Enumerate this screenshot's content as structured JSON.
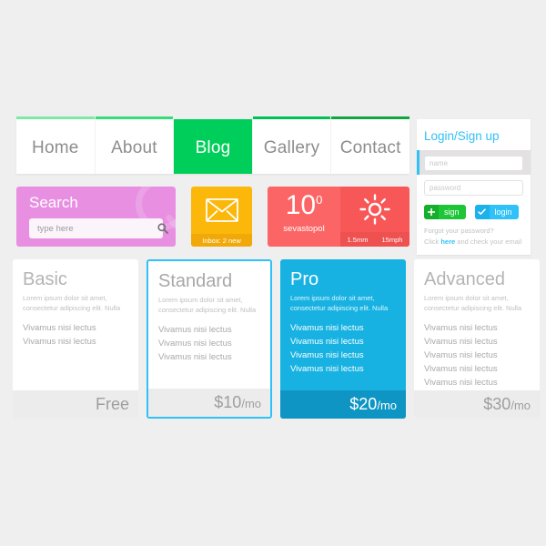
{
  "nav": {
    "items": [
      {
        "label": "Home",
        "accent": "#7ee8a5",
        "active": false
      },
      {
        "label": "About",
        "accent": "#34dd78",
        "active": false
      },
      {
        "label": "Blog",
        "accent": "#00ce5a",
        "active": true
      },
      {
        "label": "Gallery",
        "accent": "#00c252",
        "active": false
      },
      {
        "label": "Contact",
        "accent": "#0ea63f",
        "active": false
      }
    ]
  },
  "login": {
    "title": "Login/Sign up",
    "name_placeholder": "name",
    "name_value": "",
    "password_placeholder": "password",
    "password_value": "",
    "sign_label": "sign",
    "sign_icon": "plus-icon",
    "login_label": "login",
    "login_icon": "check-icon",
    "forgot_text": "Forgot your password?",
    "click_prefix": "Click ",
    "click_link": "here",
    "click_suffix": " and check your email",
    "accent": "#2fc1f7"
  },
  "search": {
    "title": "Search",
    "placeholder": "type here",
    "value": "",
    "icon": "magnifier-icon",
    "color": "#e88fe2"
  },
  "mail": {
    "icon": "envelope-icon",
    "footer": "Inbox: 2 new",
    "color": "#fcb70b"
  },
  "weather": {
    "temperature": "10",
    "degree": "0",
    "city": "sevastopol",
    "icon": "sun-icon",
    "rainfall": "1.5mm",
    "wind": "15mph",
    "color": "#fc6565"
  },
  "pricing": {
    "cards": [
      {
        "title": "Basic",
        "desc": "Lorem ipsum dolor sit amet, consectetur adipiscing elit. Nulla",
        "features": [
          "Vivamus nisi lectus",
          "Vivamus nisi lectus"
        ],
        "price": "Free",
        "per": ""
      },
      {
        "title": "Standard",
        "desc": "Lorem ipsum dolor sit amet, consectetur adipiscing elit. Nulla",
        "features": [
          "Vivamus nisi lectus",
          "Vivamus nisi lectus",
          "Vivamus nisi lectus"
        ],
        "price": "$10",
        "per": "/mo"
      },
      {
        "title": "Pro",
        "desc": "Lorem ipsum dolor sit amet, consectetur adipiscing elit. Nulla",
        "features": [
          "Vivamus nisi lectus",
          "Vivamus nisi lectus",
          "Vivamus nisi lectus",
          "Vivamus nisi lectus"
        ],
        "price": "$20",
        "per": "/mo"
      },
      {
        "title": "Advanced",
        "desc": "Lorem ipsum dolor sit amet, consectetur adipiscing elit. Nulla",
        "features": [
          "Vivamus nisi lectus",
          "Vivamus nisi lectus",
          "Vivamus nisi lectus",
          "Vivamus nisi lectus",
          "Vivamus nisi lectus"
        ],
        "price": "$30",
        "per": "/mo"
      }
    ]
  }
}
